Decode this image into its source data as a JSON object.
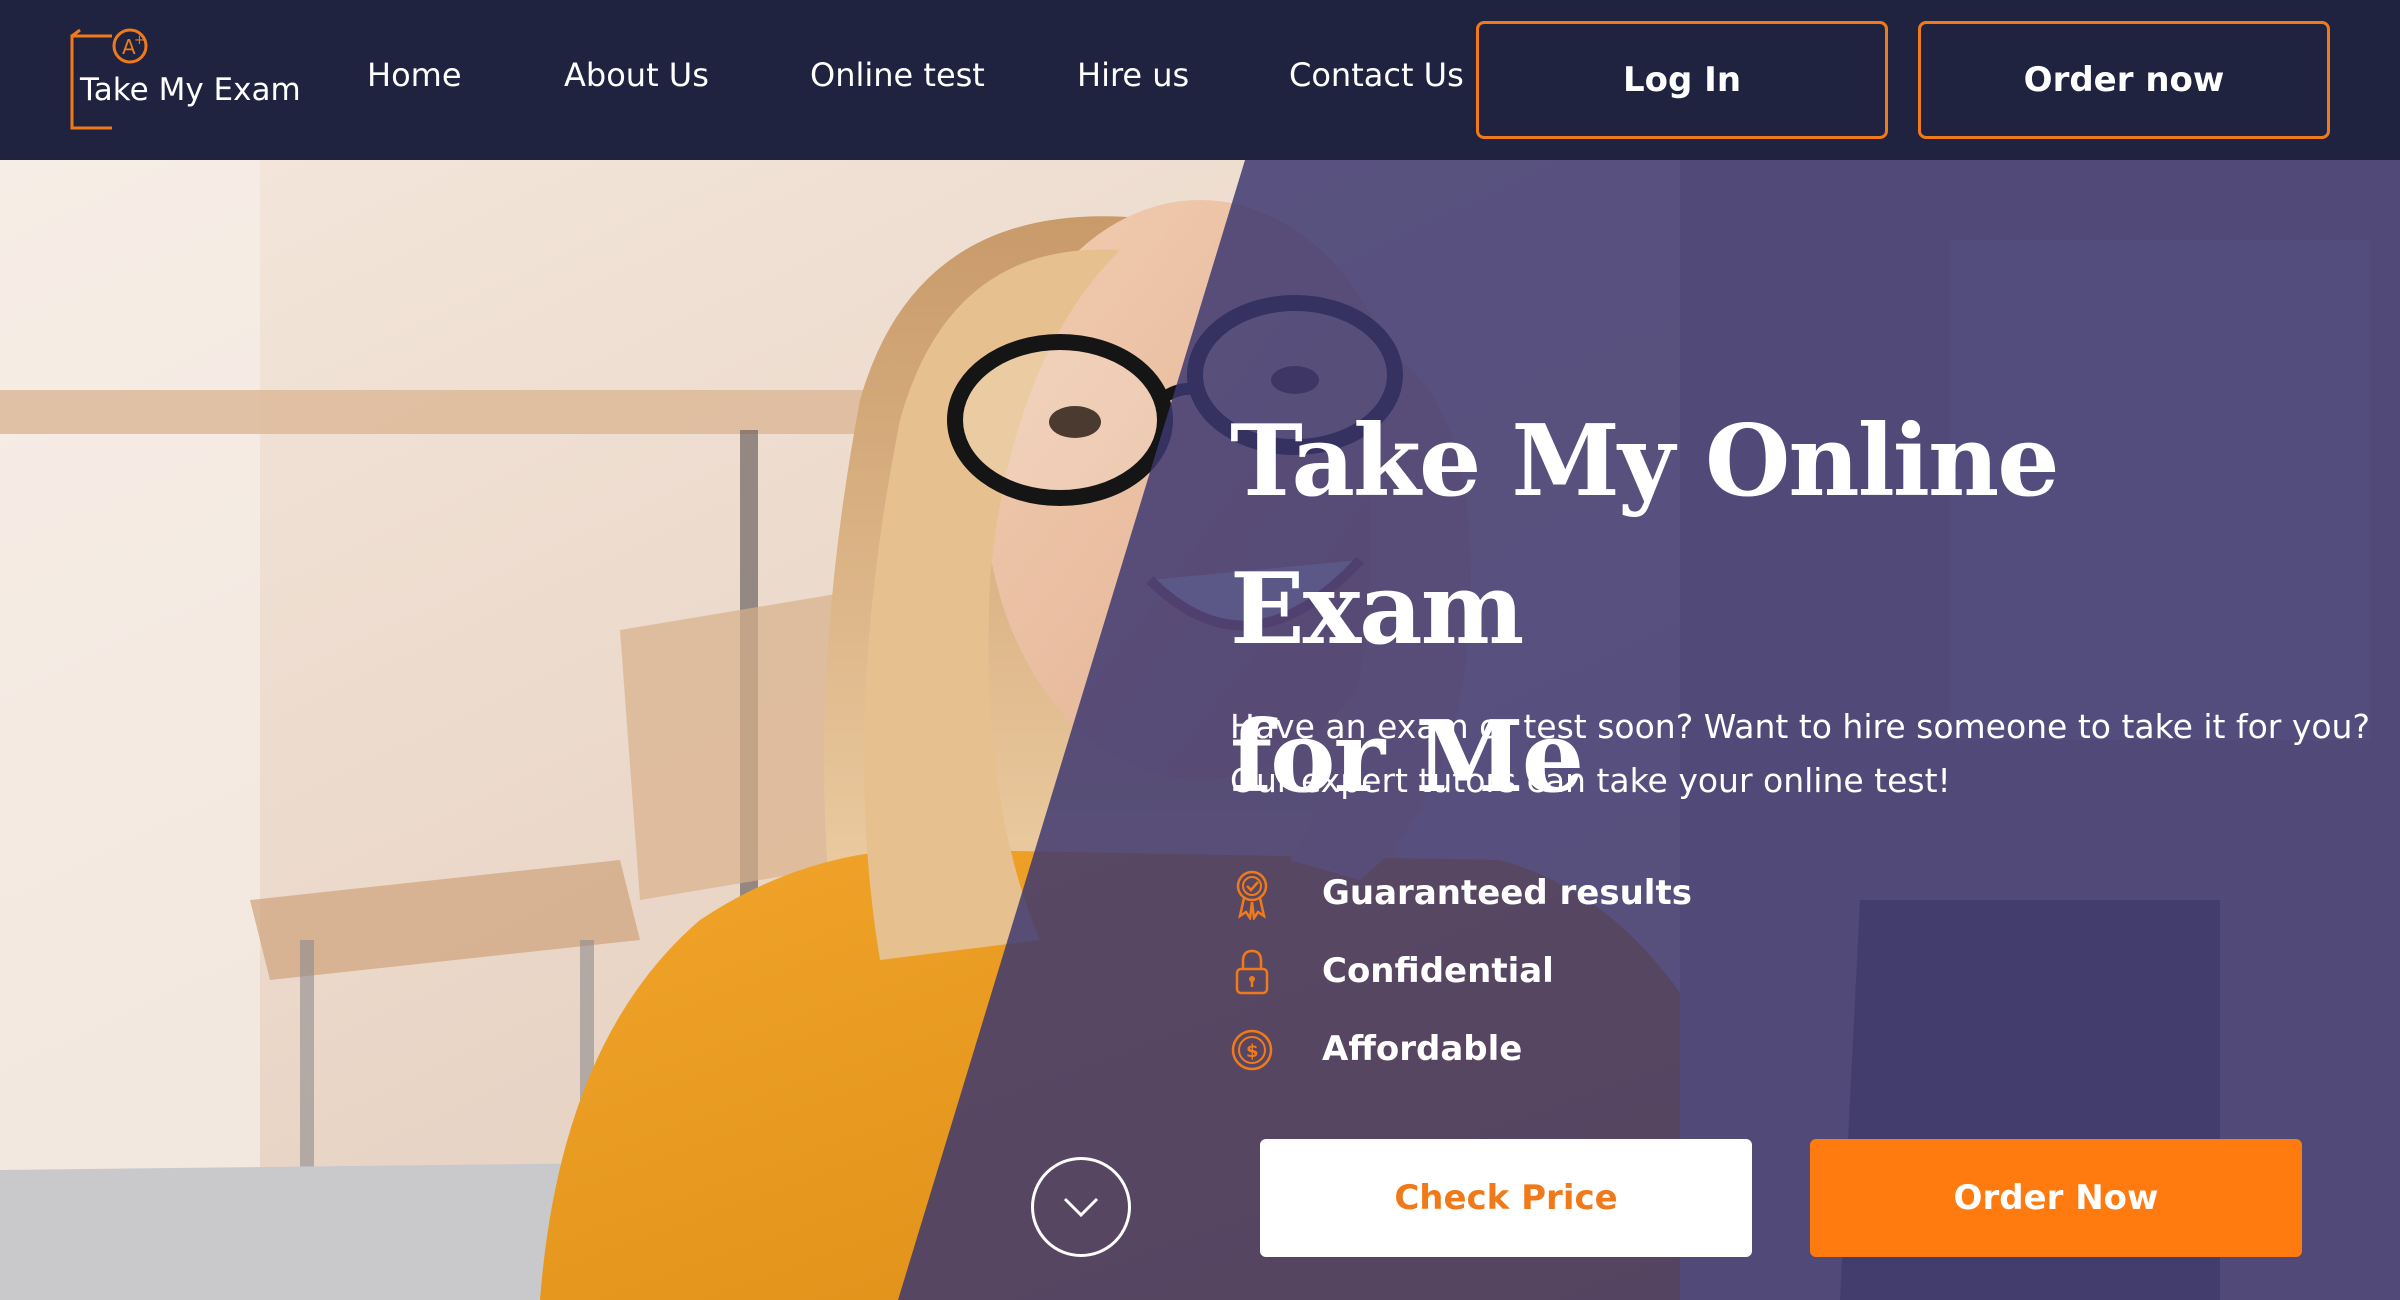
{
  "header": {
    "logo_text": "Take My Exam",
    "nav": [
      {
        "label": "Home"
      },
      {
        "label": "About Us"
      },
      {
        "label": "Online test"
      },
      {
        "label": "Hire us"
      },
      {
        "label": "Contact Us"
      }
    ],
    "login_label": "Log In",
    "order_label": "Order now"
  },
  "hero": {
    "title_line1": "Take My Online Exam",
    "title_line2": "for Me",
    "subtitle_line1": "Have an exam or test soon? Want to hire someone to take it for you?",
    "subtitle_line2": "Our expert tutors can take your online test!",
    "features": [
      {
        "label": "Guaranteed results",
        "icon": "award-badge-icon"
      },
      {
        "label": "Confidential",
        "icon": "padlock-icon"
      },
      {
        "label": "Affordable",
        "icon": "dollar-coin-icon"
      }
    ],
    "check_price_label": "Check Price",
    "order_now_label": "Order Now",
    "scroll_icon": "chevron-down-icon"
  },
  "colors": {
    "navy": "#1f2340",
    "accent_orange": "#f07a1a",
    "button_orange": "#ff7a0f",
    "overlay_purple": "#3b3770"
  }
}
